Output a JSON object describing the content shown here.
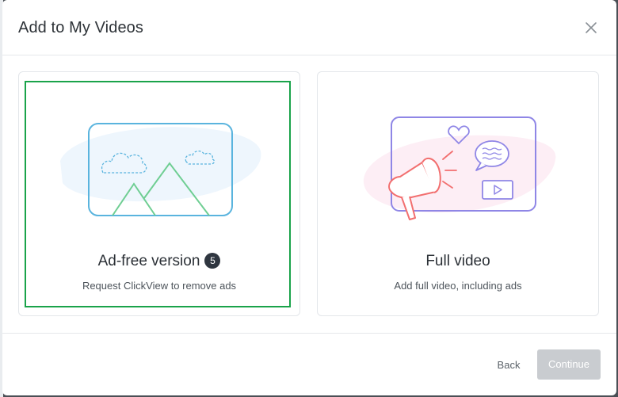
{
  "modal": {
    "title": "Add to My Videos"
  },
  "options": {
    "adfree": {
      "title": "Ad-free version",
      "badge": "5",
      "subtitle": "Request ClickView to remove ads",
      "selected": true
    },
    "full": {
      "title": "Full video",
      "subtitle": "Add full video, including ads",
      "selected": false
    }
  },
  "footer": {
    "back_label": "Back",
    "continue_label": "Continue",
    "continue_enabled": false
  },
  "colors": {
    "selected_border": "#1aa34a",
    "continue_disabled_bg": "#c9ccd0",
    "adfree_illustration": "#5ab4de",
    "mountain_green": "#6fce93",
    "full_illustration": "#8f86e6",
    "megaphone": "#f26f6f"
  },
  "icons": {
    "close": "close-icon",
    "adfree_illustration": "landscape-illustration-icon",
    "full_illustration": "megaphone-video-illustration-icon"
  }
}
